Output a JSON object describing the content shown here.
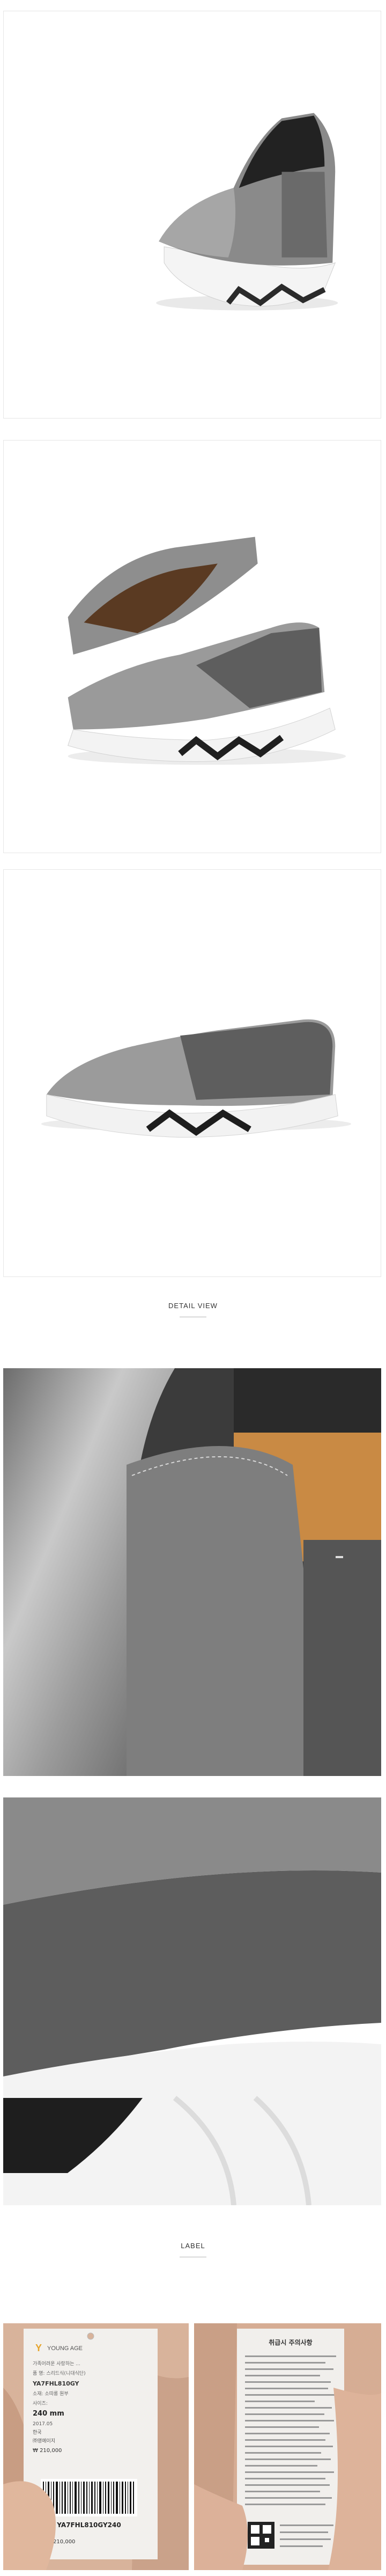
{
  "sections": {
    "detail_view": "DETAIL VIEW",
    "label": "LABEL"
  },
  "tag_front": {
    "brand": "YOUNG AGE",
    "brand_glyph": "Y",
    "lines": [
      "가족어려운 사랑하는 ...",
      "품 명: 스리드식(니대식단)",
      "YA7FHL810GY",
      "소재: 소따롱 원부",
      "사이즈:",
      "240 mm",
      "2017.05",
      "한국",
      "㈜영에이지",
      "₩ 210,000"
    ],
    "barcode_text": "YA7FHL810GY240",
    "price": "₩ 210,000"
  },
  "tag_back": {
    "title": "취급시 주의사항"
  }
}
